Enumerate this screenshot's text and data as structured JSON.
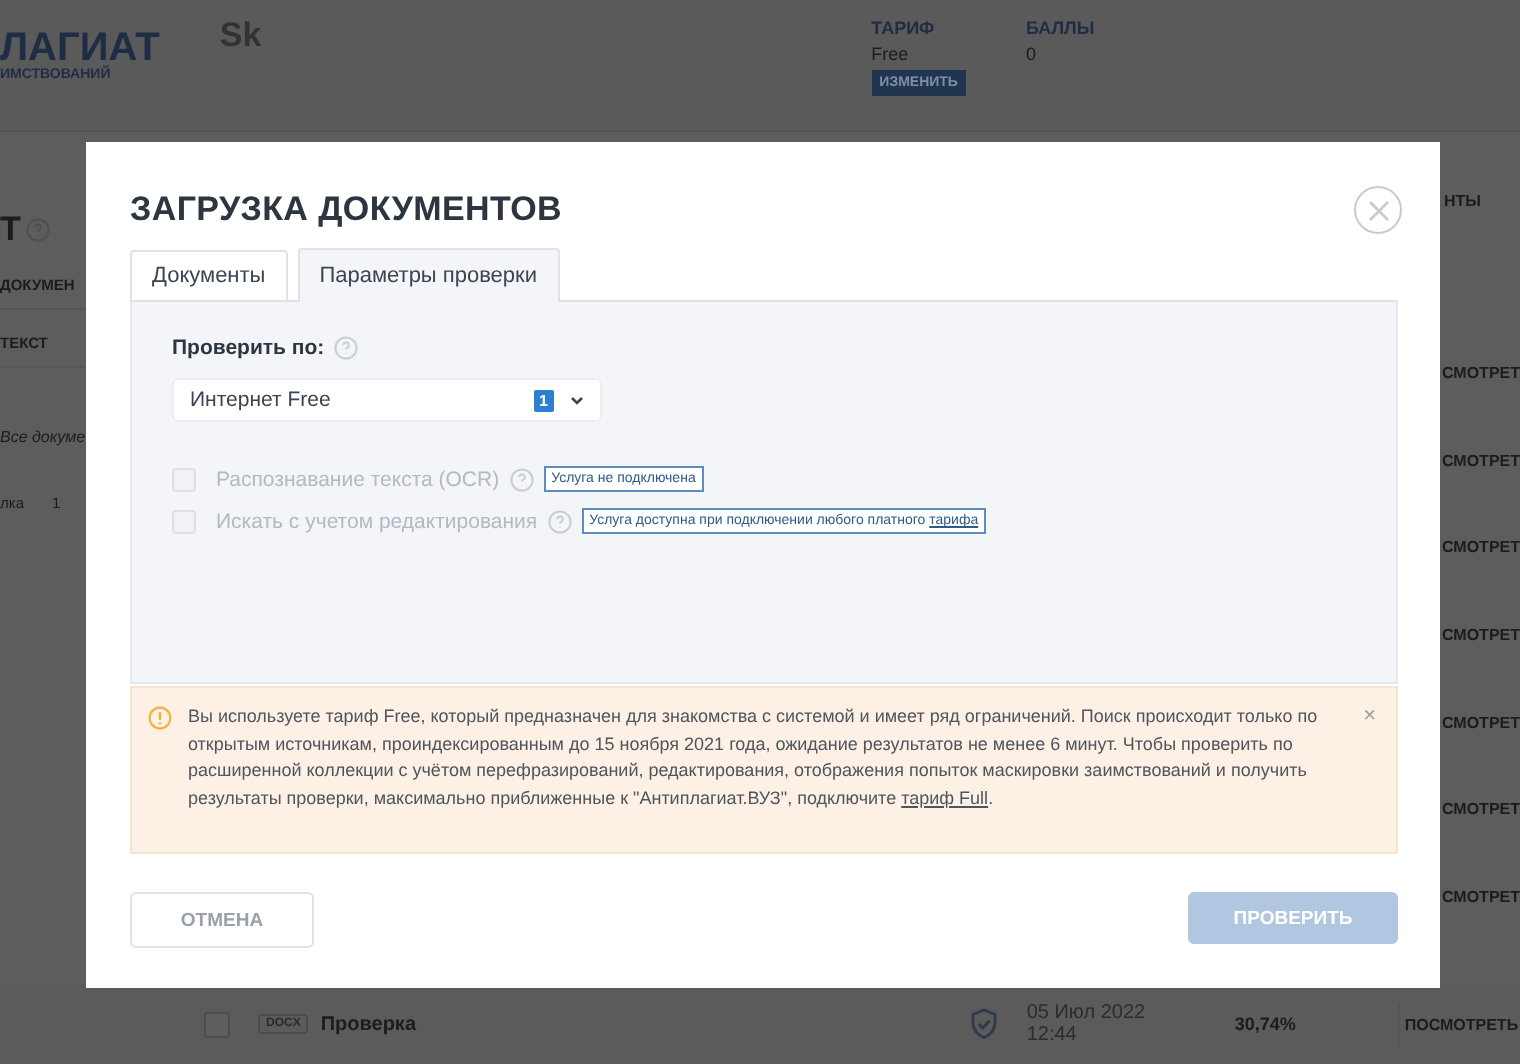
{
  "background_page": {
    "logo": {
      "title": "ЛАГИАТ",
      "subtitle": "ИМСТВОВАНИЙ"
    },
    "partner_logo": "Sk",
    "tariff": {
      "label": "ТАРИФ",
      "value": "Free",
      "button": "ИЗМЕНИТЬ"
    },
    "points": {
      "label": "БАЛЛЫ",
      "value": "0"
    },
    "sidebar": {
      "heading": "Т",
      "items": [
        "ДОКУМЕН",
        "ТЕКСТ"
      ],
      "filter": "Все докуме",
      "folder": {
        "name": "лка",
        "count": "1"
      }
    },
    "right_column": {
      "tab": "НТЫ",
      "buttons": [
        "СМОТРЕТ",
        "СМОТРЕТ",
        "СМОТРЕТ",
        "СМОТРЕТ",
        "СМОТРЕТ",
        "СМОТРЕТ",
        "СМОТРЕТ"
      ]
    },
    "document_row": {
      "checked": false,
      "format": "DOCX",
      "name": "Проверка",
      "date": "05 Июл 2022",
      "time": "12:44",
      "score": "30,74%",
      "button": "ПОСМОТРЕТЬ"
    }
  },
  "modal": {
    "title": "ЗАГРУЗКА ДОКУМЕНТОВ",
    "tabs": [
      {
        "label": "Документы",
        "selected": false
      },
      {
        "label": "Параметры проверки",
        "selected": true
      }
    ],
    "check_by": {
      "label": "Проверить по:",
      "value": "Интернет Free",
      "count": "1"
    },
    "options": [
      {
        "label": "Распознавание текста (OCR)",
        "checked": false,
        "disabled": true,
        "tag": "Услуга не подключена"
      },
      {
        "label": "Искать с учетом редактирования",
        "checked": false,
        "disabled": true,
        "tag": "Услуга доступна при подключении любого платного",
        "tag_link": "тарифа"
      }
    ],
    "notice": {
      "text": "Вы используете тариф Free, который предназначен для знакомства с системой и имеет ряд ограничений. Поиск происходит только по открытым источникам, проиндексированным до 15 ноября 2021 года, ожидание результатов не менее 6 минут. Чтобы проверить по расширенной коллекции с учётом перефразирований, редактирования, отображения попыток маскировки заимствований и получить результаты проверки, максимально приближенные к \"Антиплагиат.ВУЗ\", подключите",
      "link": "тариф Full",
      "end": ".",
      "close": "×"
    },
    "cancel_button": "ОТМЕНА",
    "submit_button": {
      "label": "ПРОВЕРИТЬ",
      "disabled": true
    }
  }
}
